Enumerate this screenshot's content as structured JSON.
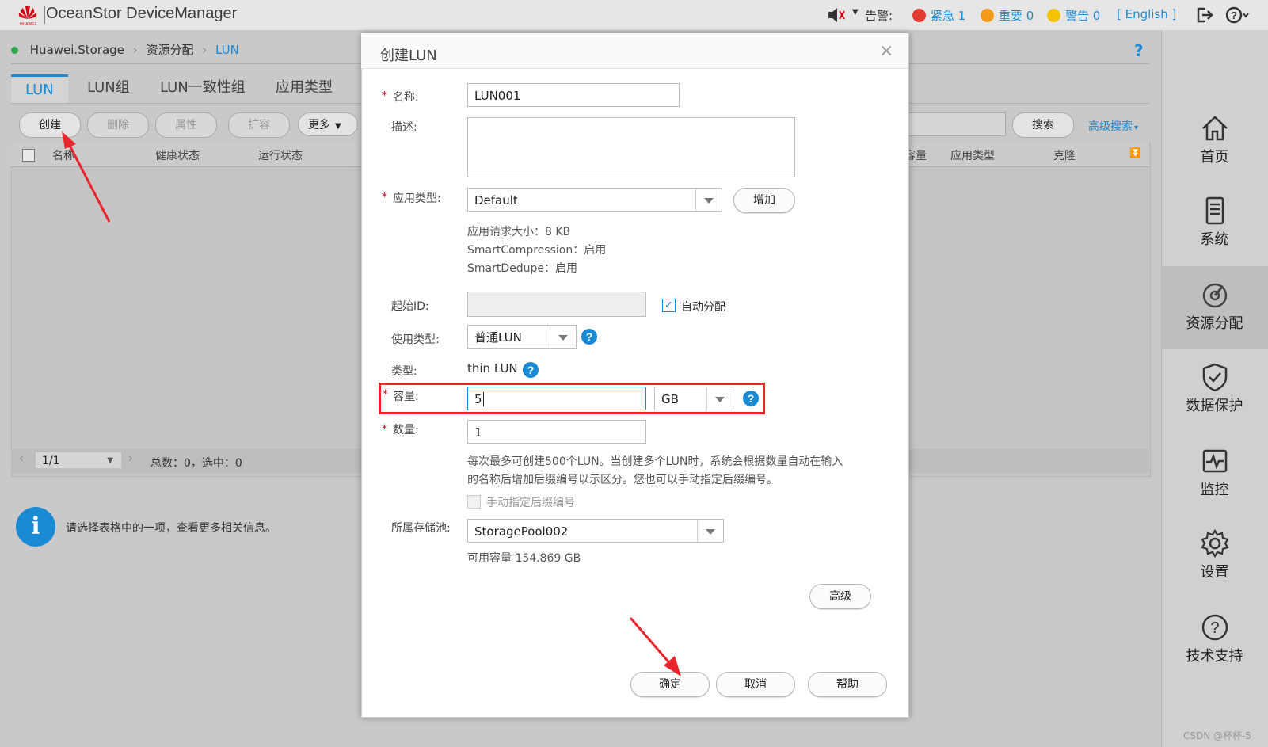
{
  "header": {
    "app_title": "OceanStor DeviceManager",
    "logo_text": "HUAWEI",
    "alarm_label": "告警:",
    "critical": "紧急 1",
    "major": "重要 0",
    "warning": "警告 0",
    "language": "[ English ]",
    "critical_color": "#e23a2e",
    "major_color": "#f29b1d",
    "warning_color": "#f5c400"
  },
  "breadcrumb": {
    "device": "Huawei.Storage",
    "section": "资源分配",
    "current": "LUN"
  },
  "tabs": [
    "LUN",
    "LUN组",
    "LUN一致性组",
    "应用类型"
  ],
  "toolbar": {
    "create": "创建",
    "delete": "删除",
    "properties": "属性",
    "expand": "扩容",
    "more": "更多",
    "search": "搜索",
    "advanced_search": "高级搜索"
  },
  "table": {
    "columns_left": [
      "名称",
      "健康状态",
      "运行状态"
    ],
    "columns_right": [
      "容量",
      "应用类型",
      "克隆"
    ],
    "page_value": "1/1",
    "summary": "总数：0，选中：0"
  },
  "info_message": "请选择表格中的一项，查看更多相关信息。",
  "nav": [
    {
      "label": "首页",
      "icon": "home-icon"
    },
    {
      "label": "系统",
      "icon": "system-icon"
    },
    {
      "label": "资源分配",
      "icon": "provisioning-icon"
    },
    {
      "label": "数据保护",
      "icon": "shield-icon"
    },
    {
      "label": "监控",
      "icon": "monitor-icon"
    },
    {
      "label": "设置",
      "icon": "gear-icon"
    },
    {
      "label": "技术支持",
      "icon": "support-icon"
    }
  ],
  "dialog": {
    "title": "创建LUN",
    "name_label": "名称:",
    "name_value": "LUN001",
    "desc_label": "描述:",
    "app_type_label": "应用类型:",
    "app_type_value": "Default",
    "add_button": "增加",
    "app_info_1": "应用请求大小：8 KB",
    "app_info_2": "SmartCompression：启用",
    "app_info_3": "SmartDedupe：启用",
    "start_id_label": "起始ID:",
    "auto_assign": "自动分配",
    "usage_type_label": "使用类型:",
    "usage_type_value": "普通LUN",
    "type_label": "类型:",
    "type_value": "thin LUN",
    "capacity_label": "容量:",
    "capacity_value": "5",
    "capacity_unit": "GB",
    "quantity_label": "数量:",
    "quantity_value": "1",
    "quantity_note_1": "每次最多可创建500个LUN。当创建多个LUN时，系统会根据数量自动在输入",
    "quantity_note_2": "的名称后增加后缀编号以示区分。您也可以手动指定后缀编号。",
    "manual_suffix": "手动指定后缀编号",
    "pool_label": "所属存储池:",
    "pool_value": "StoragePool002",
    "pool_available": "可用容量 154.869 GB",
    "advanced_button": "高级",
    "ok_button": "确定",
    "cancel_button": "取消",
    "help_button": "帮助"
  },
  "watermark": "CSDN @杯杯-5"
}
